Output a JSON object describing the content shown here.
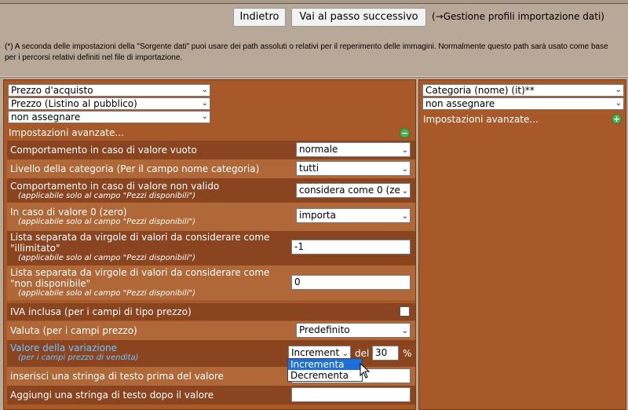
{
  "nav": {
    "back_label": "Indietro",
    "next_label": "Vai al passo successivo",
    "profiles_link": "(→Gestione profili importazione dati)"
  },
  "note": "(*) A seconda delle impostazioni della \"Sorgente dati\" puoi usare dei path assoluti o relativi per il reperimento delle immagini. Normalmente questo path sarà usato come base per i percorsi relativi definiti nel file di importazione.",
  "left": {
    "selects": [
      "Prezzo d'acquisto",
      "Prezzo (Listino al pubblico)",
      "non assegnare"
    ],
    "advanced_label": "Impostazioni avanzate...",
    "settings": {
      "empty_label": "Comportamento in caso di valore vuoto",
      "empty_value": "normale",
      "level_label": "Livello della categoria (Per il campo nome categoria)",
      "level_value": "tutti",
      "invalid_label": "Comportamento in caso di valore non valido",
      "invalid_sub": "(applicabile solo al campo \"Pezzi disponibili\")",
      "invalid_value": "considera come 0 (ze",
      "zero_label": "In caso di valore 0 (zero)",
      "zero_sub": "(applicabile solo al campo \"Pezzi disponibili\")",
      "zero_value": "importa",
      "unlimited_label_1": "Lista separata da virgole di valori da considerare come",
      "unlimited_label_2": "\"illimitato\"",
      "unlimited_sub": "(applicabile solo al campo \"Pezzi disponibili\")",
      "unlimited_value": "-1",
      "unavailable_label_1": "Lista separata da virgole di valori da considerare come",
      "unavailable_label_2": "\"non disponibile\"",
      "unavailable_sub": "(applicabile solo al campo \"Pezzi disponibili\")",
      "unavailable_value": "0",
      "vat_label": "IVA inclusa (per i campi di tipo prezzo)",
      "currency_label": "Valuta (per i campi prezzo)",
      "currency_value": "Predefinito",
      "variation_label": "Valore della variazione",
      "variation_sub": "(per i campi prezzo di vendita)",
      "variation_select": "Increment",
      "variation_del": "del",
      "variation_value": "30",
      "variation_unit": "%",
      "variation_options": [
        "Incrementa",
        "Decrementa"
      ],
      "prefix_label": "inserisci una stringa di testo prima del valore",
      "suffix_label": "Aggiungi una stringa di testo dopo il valore"
    }
  },
  "right": {
    "selects": [
      "Categoria (nome) (it)**",
      "non assegnare"
    ],
    "advanced_label": "Impostazioni avanzate..."
  }
}
